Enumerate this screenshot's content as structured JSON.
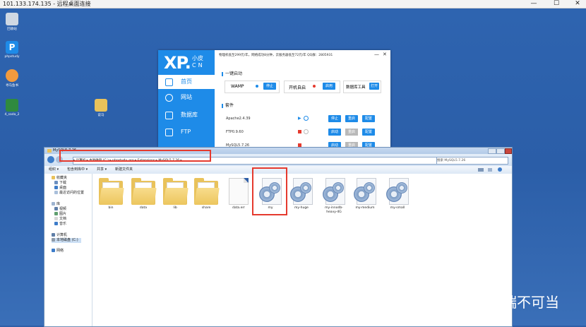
{
  "rdp": {
    "title": "101.133.174.135 - 远程桌面连接",
    "minimize": "—",
    "restore": "☐",
    "close": "✕"
  },
  "desktop": {
    "icons": [
      {
        "label": "回收站",
        "icon": "recycle-bin-icon",
        "color": "#cfd8e3"
      },
      {
        "label": "phpstudy",
        "icon": "phpstudy-icon",
        "color": "#1e8be8"
      },
      {
        "label": "寻马鱼书",
        "icon": "app-icon",
        "color": "#f19a3e"
      },
      {
        "label": "4_sada_2",
        "icon": "excel-icon",
        "color": "#2f8a3e"
      },
      {
        "label": "说马",
        "icon": "folder-icon",
        "color": "#e9c25a"
      }
    ]
  },
  "xp_panel": {
    "logo": "XP.",
    "logo_small_top": "小皮",
    "logo_small_bottom": "CN",
    "notice": "物理机低至299元/年，网络成功8分钟，云服务器低至72元/年  QQ群：2805931",
    "minimize": "—",
    "close": "✕",
    "nav": [
      {
        "label": "首页",
        "icon": "home-icon"
      },
      {
        "label": "网站",
        "icon": "globe-icon"
      },
      {
        "label": "数据库",
        "icon": "database-icon"
      },
      {
        "label": "FTP",
        "icon": "ftp-icon"
      }
    ],
    "quick_start": {
      "title": "一键启动",
      "wamp_label": "WAMP",
      "wamp_stop": "停止",
      "autostart_label": "开机自启",
      "autostart_btn": "启用",
      "dbtool_label": "数据库工具",
      "dbtool_btn": "打开"
    },
    "services": {
      "title": "套件",
      "rows": [
        {
          "name": "Apache2.4.39",
          "status_color": "#1e8be8",
          "b1": "停止",
          "b2": "重启",
          "b3": "配置"
        },
        {
          "name": "FTP0.9.60",
          "status_color": "#e53a2e",
          "b1": "启动",
          "b2": "重启",
          "b3": "配置"
        },
        {
          "name": "MySQL5.7.26",
          "status_color": "#e53a2e",
          "b1": "启动",
          "b2": "重启",
          "b3": "配置"
        }
      ]
    }
  },
  "explorer": {
    "title": "MySQL5.7.26",
    "address": "▸ 计算机 ▸ 本地磁盘 (C:) ▸ phpstudy_pro ▸ Extensions ▸ MySQL5.7.26 ▸",
    "search_placeholder": "搜索 MySQL5.7.26",
    "toolbar": {
      "organize": "组织 ▾",
      "include": "包含到库中 ▾",
      "share": "共享 ▾",
      "new_folder": "新建文件夹"
    },
    "nav": {
      "favorites": "收藏夹",
      "downloads": "下载",
      "desktop": "桌面",
      "recent": "最近访问的位置",
      "libraries": "库",
      "videos": "视频",
      "pictures": "图片",
      "documents": "文档",
      "music": "音乐",
      "computer": "计算机",
      "local_disk": "本地磁盘 (C:)",
      "network": "网络"
    },
    "files": [
      {
        "name": "bin",
        "kind": "folder"
      },
      {
        "name": "data",
        "kind": "folder"
      },
      {
        "name": "lib",
        "kind": "folder"
      },
      {
        "name": "share",
        "kind": "folder"
      },
      {
        "name": "data.err",
        "kind": "doc"
      },
      {
        "name": "my",
        "kind": "config"
      },
      {
        "name": "my-huge",
        "kind": "config"
      },
      {
        "name": "my-innodb-heavy-4G",
        "kind": "config"
      },
      {
        "name": "my-medium",
        "kind": "config"
      },
      {
        "name": "my-small",
        "kind": "config"
      }
    ]
  },
  "watermark": "瑞不可当"
}
